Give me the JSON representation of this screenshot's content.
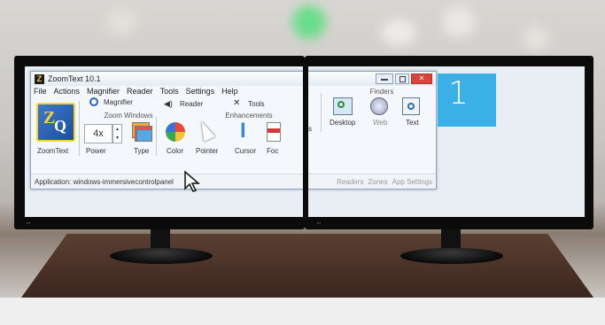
{
  "app": {
    "title": "ZoomText 10.1",
    "menu": [
      "File",
      "Actions",
      "Magnifier",
      "Reader",
      "Tools",
      "Settings",
      "Help"
    ]
  },
  "ribbon": {
    "tabs": [
      "Magnifier",
      "Reader",
      "Tools"
    ],
    "logo_label": "ZoomText",
    "zoom_windows_group": "Zoom Windows",
    "power_value": "4x",
    "power_label": "Power",
    "type_label": "Type",
    "enhancements_group": "Enhancements",
    "color_label": "Color",
    "pointer_label": "Pointer",
    "cursor_label": "Cursor",
    "focus_label_partial": "Foc",
    "finders_group": "Finders",
    "desktop_label": "Desktop",
    "web_label": "Web",
    "text_label": "Text",
    "partial_s": "s"
  },
  "status": {
    "application_text": "Application:  windows-immersivecontrolpanel",
    "right_links": [
      "Readers",
      "Zones",
      "App Settings"
    ]
  },
  "second_screen": {
    "tile_number": "1"
  },
  "colors": {
    "tile_blue": "#3bb0e6",
    "ribbon_bg": "#f4f7fb",
    "close_red": "#d9453c",
    "logo_yellow": "#f5d23a"
  }
}
